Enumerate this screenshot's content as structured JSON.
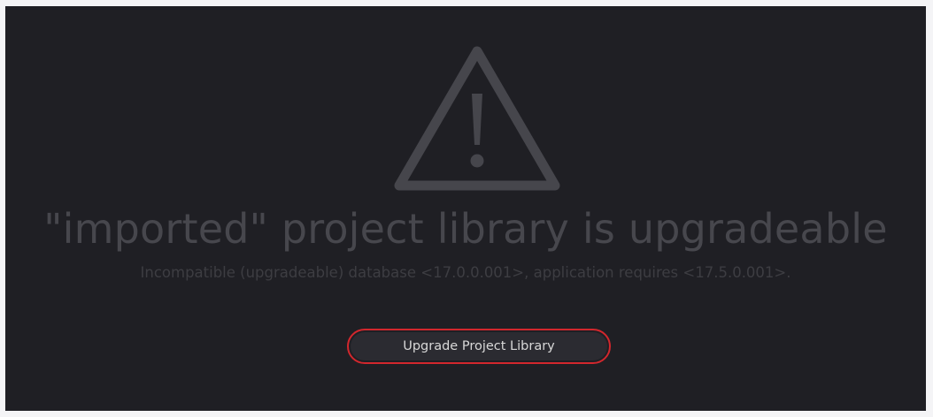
{
  "dialog": {
    "icon": "warning-triangle-icon",
    "title": "\"imported\" project library is upgradeable",
    "message": "Incompatible (upgradeable) database <17.0.0.001>, application requires <17.5.0.001>.",
    "button_label": "Upgrade Project Library"
  },
  "colors": {
    "background": "#1f1f24",
    "icon": "#46464c",
    "title_text": "#47474d",
    "message_text": "#3d3d42",
    "button_border": "#d2272d",
    "button_text": "#d8d8d8"
  }
}
